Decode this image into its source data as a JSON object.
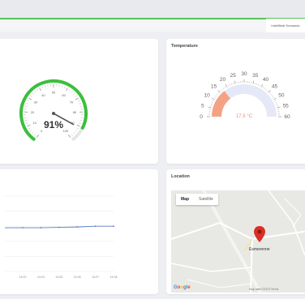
{
  "header": {
    "tab_label": "Intellifiedt Sorauesh"
  },
  "humidity": {
    "title": "",
    "value_label": "91%",
    "value": 91,
    "min": 0,
    "max": 100,
    "ticks": [
      "0",
      "10",
      "20",
      "30",
      "40",
      "50",
      "60",
      "70",
      "80",
      "90",
      "100"
    ],
    "accent": "#3bbf3c"
  },
  "temperature": {
    "title": "Temperature",
    "value_label": "17.5 °C",
    "value": 17.5,
    "min": 0,
    "max": 60,
    "ticks": [
      "0",
      "5",
      "10",
      "15",
      "20",
      "25",
      "30",
      "35",
      "40",
      "45",
      "50",
      "55",
      "60"
    ],
    "accent": "#f4a285",
    "track": "#e5e8f6"
  },
  "chart": {
    "title": "",
    "chart_data": {
      "type": "line",
      "x": [
        "14:22",
        "14:24",
        "14:25",
        "14:26",
        "14:27",
        "14:28"
      ],
      "series": [
        {
          "values": [
            0.58,
            0.58,
            0.585,
            0.59,
            0.6,
            0.6
          ]
        }
      ],
      "ylim": [
        0,
        1
      ],
      "grid": true,
      "color": "#5a7fc4"
    }
  },
  "map": {
    "title": "Location",
    "tab_map": "Map",
    "tab_satellite": "Satellite",
    "place_label": "Esmerenne",
    "footer": "Map data ©2023  Terms",
    "google": "Google",
    "marker_color": "#d93025"
  }
}
